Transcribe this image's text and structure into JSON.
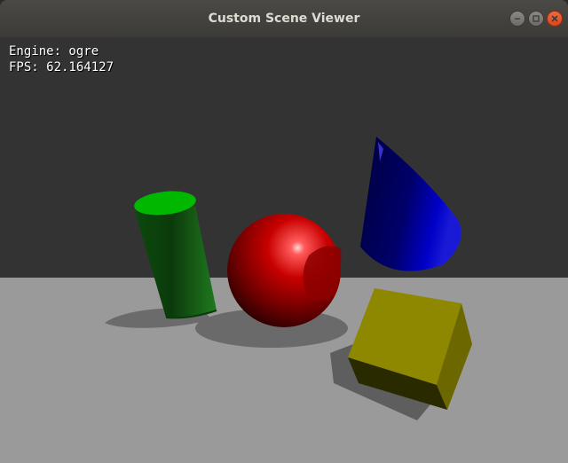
{
  "window": {
    "title": "Custom Scene Viewer",
    "controls": {
      "minimize": "minimize-icon",
      "maximize": "maximize-icon",
      "close": "close-icon"
    }
  },
  "overlay": {
    "engine_label": "Engine: ogre",
    "fps_label": "FPS: 62.164127"
  },
  "scene": {
    "background_color": "#333333",
    "ground_color": "#9a9a9a",
    "objects": [
      {
        "name": "cylinder",
        "color": "#00b000"
      },
      {
        "name": "sphere",
        "color": "#cc0000"
      },
      {
        "name": "cone",
        "color": "#0000c0"
      },
      {
        "name": "box",
        "color": "#8c8400"
      }
    ]
  }
}
